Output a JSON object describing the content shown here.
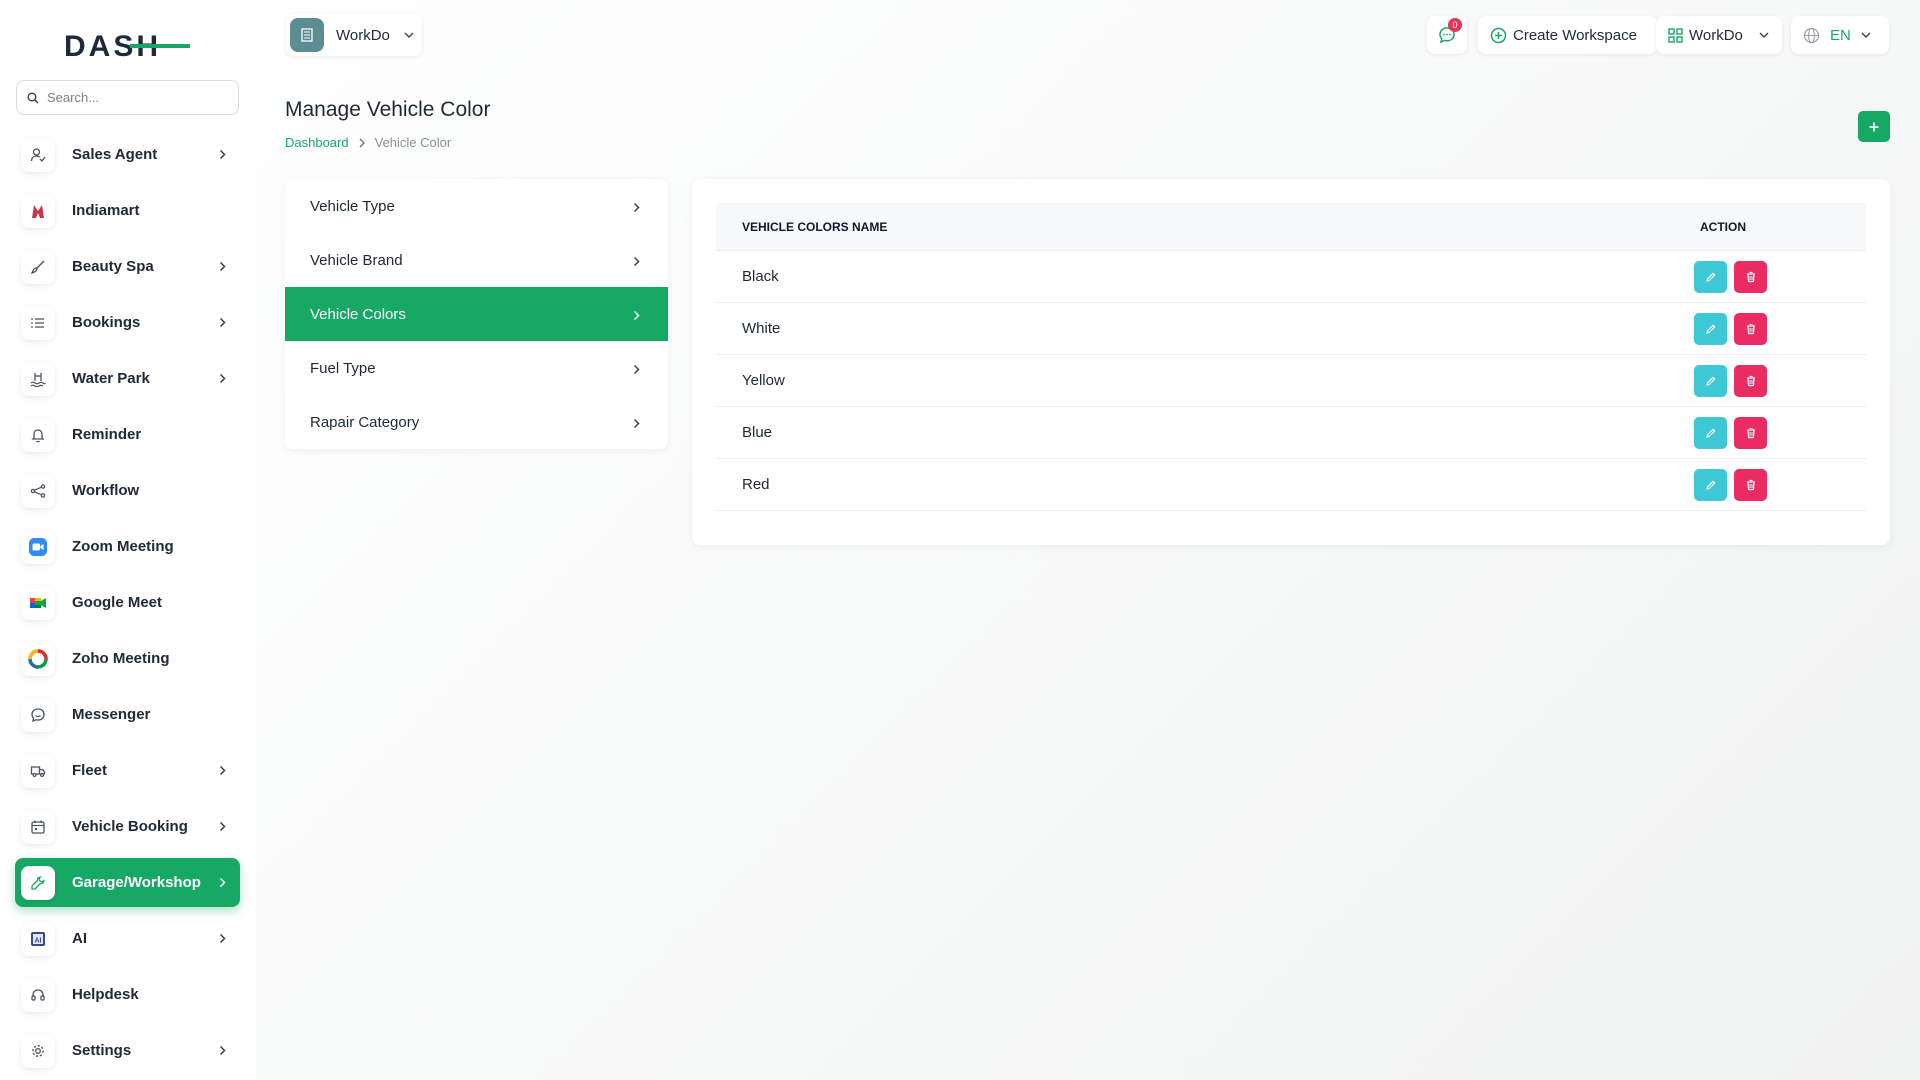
{
  "app": {
    "logo_text": "DASH",
    "search_placeholder": "Search..."
  },
  "sidebar": {
    "items": [
      {
        "label": "Sales Agent",
        "icon": "user-icon",
        "has_chevron": true
      },
      {
        "label": "Indiamart",
        "icon": "indiamart-logo-icon",
        "has_chevron": false
      },
      {
        "label": "Beauty Spa",
        "icon": "brush-icon",
        "has_chevron": true
      },
      {
        "label": "Bookings",
        "icon": "list-icon",
        "has_chevron": true
      },
      {
        "label": "Water Park",
        "icon": "swimmer-icon",
        "has_chevron": true
      },
      {
        "label": "Reminder",
        "icon": "bell-icon",
        "has_chevron": false
      },
      {
        "label": "Workflow",
        "icon": "workflow-icon",
        "has_chevron": false
      },
      {
        "label": "Zoom Meeting",
        "icon": "zoom-icon",
        "has_chevron": false
      },
      {
        "label": "Google Meet",
        "icon": "google-meet-icon",
        "has_chevron": false
      },
      {
        "label": "Zoho Meeting",
        "icon": "zoho-icon",
        "has_chevron": false
      },
      {
        "label": "Messenger",
        "icon": "chat-icon",
        "has_chevron": false
      },
      {
        "label": "Fleet",
        "icon": "truck-icon",
        "has_chevron": true
      },
      {
        "label": "Vehicle Booking",
        "icon": "calendar-icon",
        "has_chevron": true
      },
      {
        "label": "Garage/Workshop",
        "icon": "wrench-icon",
        "has_chevron": true,
        "active": true
      },
      {
        "label": "AI",
        "icon": "ai-chip-icon",
        "has_chevron": true
      },
      {
        "label": "Helpdesk",
        "icon": "headset-icon",
        "has_chevron": false
      },
      {
        "label": "Settings",
        "icon": "gear-icon",
        "has_chevron": true
      }
    ]
  },
  "header": {
    "workspace_name": "WorkDo",
    "message_count": "0",
    "create_workspace_label": "Create Workspace",
    "workdo_label": "WorkDo",
    "language": "EN"
  },
  "page": {
    "title": "Manage Vehicle Color",
    "breadcrumb": [
      "Dashboard",
      "Vehicle Color"
    ]
  },
  "settings_menu": [
    {
      "label": "Vehicle Type"
    },
    {
      "label": "Vehicle Brand"
    },
    {
      "label": "Vehicle Colors",
      "active": true
    },
    {
      "label": "Fuel Type"
    },
    {
      "label": "Rapair Category"
    }
  ],
  "table": {
    "headers": [
      "VEHICLE COLORS NAME",
      "ACTION"
    ],
    "rows": [
      "Black",
      "White",
      "Yellow",
      "Blue",
      "Red"
    ]
  },
  "colors": {
    "accent": "#18a865",
    "edit": "#3ec8d6",
    "delete": "#ea2c62",
    "badge": "#e8335a"
  }
}
